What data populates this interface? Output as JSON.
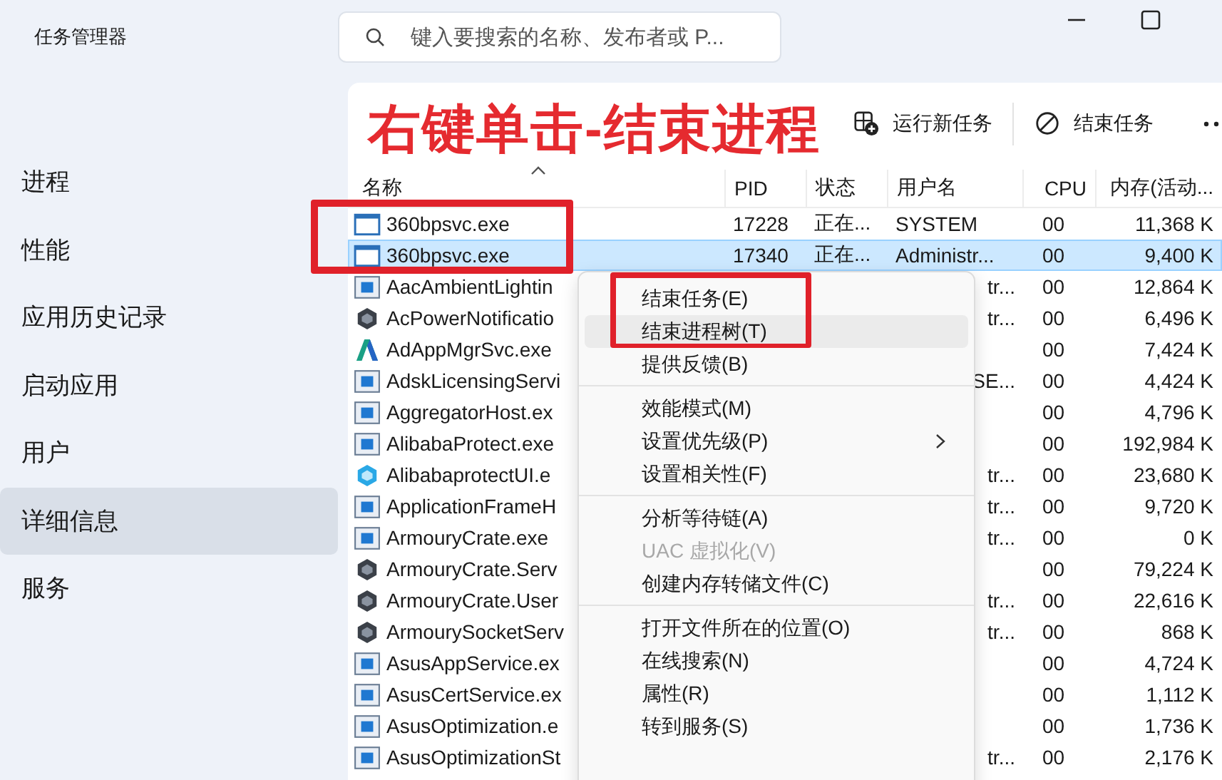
{
  "window": {
    "title": "任务管理器"
  },
  "search": {
    "placeholder": "键入要搜索的名称、发布者或 P..."
  },
  "sidebar": {
    "items": [
      {
        "label": "进程",
        "selected": false
      },
      {
        "label": "性能",
        "selected": false
      },
      {
        "label": "应用历史记录",
        "selected": false
      },
      {
        "label": "启动应用",
        "selected": false
      },
      {
        "label": "用户",
        "selected": false
      },
      {
        "label": "详细信息",
        "selected": true
      },
      {
        "label": "服务",
        "selected": false
      }
    ]
  },
  "toolbar": {
    "buttons": [
      {
        "kind": "run",
        "label": "运行新任务"
      },
      {
        "kind": "end",
        "label": "结束任务"
      }
    ]
  },
  "annotation": {
    "text": "右键单击-结束进程"
  },
  "table": {
    "columns": [
      "名称",
      "PID",
      "状态",
      "用户名",
      "CPU",
      "内存(活动..."
    ],
    "rows": [
      {
        "kind": "window",
        "selected": false,
        "name": "360bpsvc.exe",
        "pid": "17228",
        "status": "正在...",
        "user": "SYSTEM",
        "cpu": "00",
        "memory": "11,368 K"
      },
      {
        "kind": "window",
        "selected": true,
        "name": "360bpsvc.exe",
        "pid": "17340",
        "status": "正在...",
        "user": "Administr...",
        "cpu": "00",
        "memory": "9,400 K"
      },
      {
        "kind": "app",
        "selected": false,
        "name": "AacAmbientLightin",
        "user": "tr...",
        "user_cut": true,
        "cpu": "00",
        "memory": "12,864 K"
      },
      {
        "kind": "dark",
        "selected": false,
        "name": "AcPowerNotificatio",
        "user": "tr...",
        "user_cut": true,
        "cpu": "00",
        "memory": "6,496 K"
      },
      {
        "kind": "logo",
        "selected": false,
        "name": "AdAppMgrSvc.exe",
        "cpu": "00",
        "memory": "7,424 K"
      },
      {
        "kind": "app",
        "selected": false,
        "name": "AdskLicensingServi",
        "user": "SE...",
        "user_cut": true,
        "cpu": "00",
        "memory": "4,424 K"
      },
      {
        "kind": "app",
        "selected": false,
        "name": "AggregatorHost.ex",
        "cpu": "00",
        "memory": "4,796 K"
      },
      {
        "kind": "app",
        "selected": false,
        "name": "AlibabaProtect.exe",
        "cpu": "00",
        "memory": "192,984 K"
      },
      {
        "kind": "hex",
        "selected": false,
        "name": "AlibabaprotectUI.e",
        "user": "tr...",
        "user_cut": true,
        "cpu": "00",
        "memory": "23,680 K"
      },
      {
        "kind": "app",
        "selected": false,
        "name": "ApplicationFrameH",
        "user": "tr...",
        "user_cut": true,
        "cpu": "00",
        "memory": "9,720 K"
      },
      {
        "kind": "app",
        "selected": false,
        "name": "ArmouryCrate.exe",
        "user": "tr...",
        "user_cut": true,
        "cpu": "00",
        "memory": "0 K"
      },
      {
        "kind": "dark",
        "selected": false,
        "name": "ArmouryCrate.Serv",
        "cpu": "00",
        "memory": "79,224 K"
      },
      {
        "kind": "dark",
        "selected": false,
        "name": "ArmouryCrate.User",
        "user": "tr...",
        "user_cut": true,
        "cpu": "00",
        "memory": "22,616 K"
      },
      {
        "kind": "dark",
        "selected": false,
        "name": "ArmourySocketServ",
        "user": "tr...",
        "user_cut": true,
        "cpu": "00",
        "memory": "868 K"
      },
      {
        "kind": "app",
        "selected": false,
        "name": "AsusAppService.ex",
        "cpu": "00",
        "memory": "4,724 K"
      },
      {
        "kind": "app",
        "selected": false,
        "name": "AsusCertService.ex",
        "cpu": "00",
        "memory": "1,112 K"
      },
      {
        "kind": "app",
        "selected": false,
        "name": "AsusOptimization.e",
        "cpu": "00",
        "memory": "1,736 K"
      },
      {
        "kind": "app",
        "selected": false,
        "name": "AsusOptimizationSt",
        "user": "tr...",
        "user_cut": true,
        "cpu": "00",
        "memory": "2,176 K"
      }
    ]
  },
  "context_menu": {
    "groups": [
      [
        {
          "label": "结束任务(E)",
          "highlighted": false,
          "disabled": false,
          "submenu": false
        },
        {
          "label": "结束进程树(T)",
          "highlighted": true,
          "disabled": false,
          "submenu": false
        },
        {
          "label": "提供反馈(B)",
          "highlighted": false,
          "disabled": false,
          "submenu": false
        }
      ],
      [
        {
          "label": "效能模式(M)",
          "highlighted": false,
          "disabled": false,
          "submenu": false
        },
        {
          "label": "设置优先级(P)",
          "highlighted": false,
          "disabled": false,
          "submenu": true
        },
        {
          "label": "设置相关性(F)",
          "highlighted": false,
          "disabled": false,
          "submenu": false
        }
      ],
      [
        {
          "label": "分析等待链(A)",
          "highlighted": false,
          "disabled": false,
          "submenu": false
        },
        {
          "label": "UAC 虚拟化(V)",
          "highlighted": false,
          "disabled": true,
          "submenu": false
        },
        {
          "label": "创建内存转储文件(C)",
          "highlighted": false,
          "disabled": false,
          "submenu": false
        }
      ],
      [
        {
          "label": "打开文件所在的位置(O)",
          "highlighted": false,
          "disabled": false,
          "submenu": false
        },
        {
          "label": "在线搜索(N)",
          "highlighted": false,
          "disabled": false,
          "submenu": false
        },
        {
          "label": "属性(R)",
          "highlighted": false,
          "disabled": false,
          "submenu": false
        },
        {
          "label": "转到服务(S)",
          "highlighted": false,
          "disabled": false,
          "submenu": false
        }
      ]
    ]
  }
}
